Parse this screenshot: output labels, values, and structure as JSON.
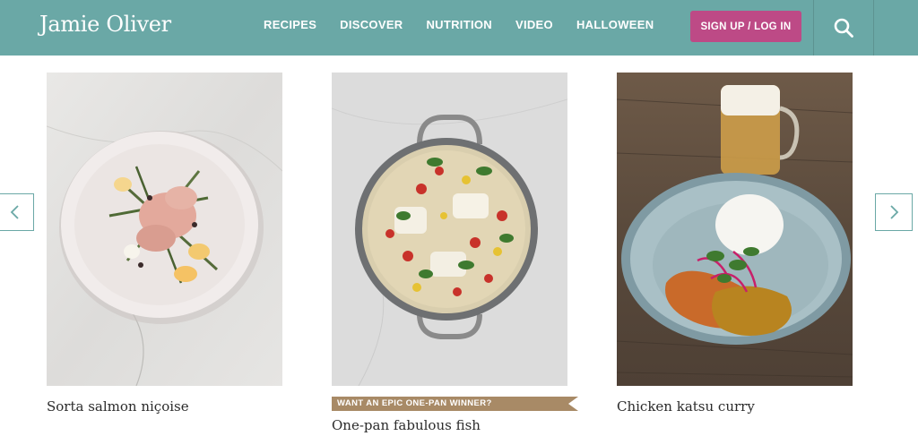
{
  "brand": {
    "logo_text": "Jamie Oliver"
  },
  "nav": {
    "items": [
      "RECIPES",
      "DISCOVER",
      "NUTRITION",
      "VIDEO",
      "HALLOWEEN"
    ]
  },
  "header": {
    "signup_label": "SIGN UP / LOG IN"
  },
  "colors": {
    "header_bg": "#6aa8a6",
    "signup_bg": "#bd4a86",
    "banner_bg": "#a88a66"
  },
  "icons": {
    "search": "search-icon",
    "prev": "chevron-left-icon",
    "next": "chevron-right-icon"
  },
  "carousel": {
    "cards": [
      {
        "title": "Sorta salmon niçoise",
        "banner": ""
      },
      {
        "title": "One-pan fabulous fish",
        "banner": "WANT AN EPIC ONE-PAN WINNER?"
      },
      {
        "title": "Chicken katsu curry",
        "banner": ""
      }
    ]
  }
}
